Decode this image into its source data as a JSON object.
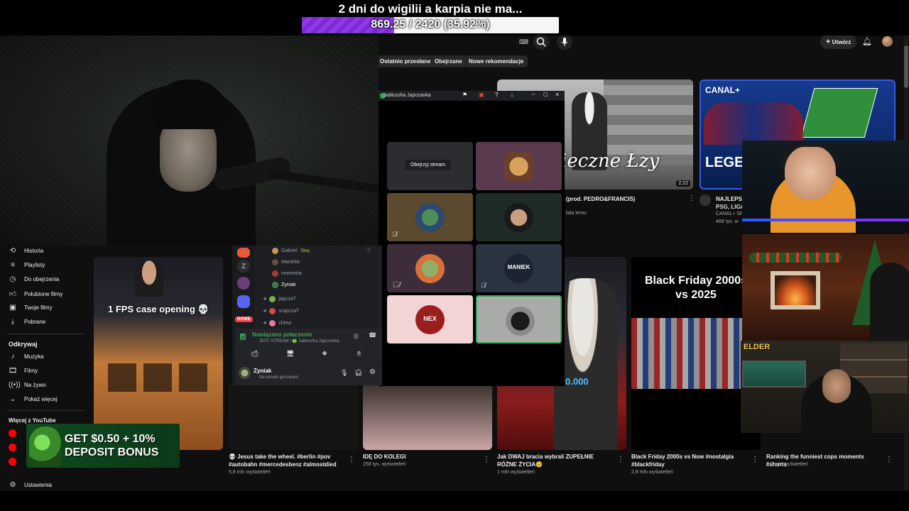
{
  "overlay": {
    "goal_title": "2 dni do wigilii a karpia nie ma...",
    "goal_text": "869.25 / 2420 (35.92%)",
    "goal_fraction": 0.3592,
    "promo_line1": "GET $0.50 + 10%",
    "promo_line2": "DEPOSIT BONUS"
  },
  "youtube": {
    "create_label": "Utwórz",
    "chips": [
      "Ostatnio przesłane",
      "Obejrzane",
      "Nowe rekomendacje"
    ],
    "sidebar": {
      "items": [
        "Historia",
        "Playlisty",
        "Do obejrzenia",
        "Polubione filmy",
        "Twoje filmy",
        "Pobrane"
      ],
      "explore_heading": "Odkrywaj",
      "explore_items": [
        "Muzyka",
        "Filmy",
        "Na żywo",
        "Pokaż więcej"
      ],
      "more_heading": "Więcej z YouTube",
      "settings": "Ustawienia"
    },
    "top_videos": [
      {
        "thumb_text": "ieczne Łzy",
        "duration": "2:22",
        "title": "(prod. PEDRO&FRANCIS)",
        "meta": "lata temu"
      },
      {
        "thumb_brand": "CANAL+",
        "thumb_text": "LEGE",
        "title": "NAJLEPSZ",
        "meta1": "PSG, LIGA",
        "meta2": "CANAL+ SP",
        "meta3": "468 tys. w"
      }
    ],
    "bottom_videos": [
      {
        "thumb_text": "1 FPS case opening 💀",
        "title": "💀 Jesus take the wheel. #berlin #pov #autobahn #mercedesbenz #almostdied",
        "meta": "5,8 mln wyświetleń"
      },
      {
        "title": "IDĘ DO KOLEGI",
        "meta": "258 tys. wyświetleń"
      },
      {
        "thumb_text": "0.000",
        "title": "Jak DWAJ bracia wybrali ZUPEŁNIE RÓŻNE ŻYCIA🥺",
        "meta": "1 mln wyświetleń"
      },
      {
        "thumb_text": "Black Friday 2000s vs 2025",
        "title": "Black Friday 2000s vs Now #nostalgia #blackfriday",
        "meta": "2,8 mln wyświetleń"
      },
      {
        "title": "Ranking the funniest cops moments #shorts",
        "meta": "6,7 mln wyświetleń"
      }
    ]
  },
  "discord_call": {
    "window_title": "Jabłuszka Japczanka",
    "watch_stream": "Obejrzyj stream",
    "tile_labels": [
      "MANIEK",
      "NEX"
    ]
  },
  "discord_panel": {
    "server_badge": "NOWE",
    "voice_users": [
      {
        "name": "Gabriel",
        "tag": "78sq"
      },
      {
        "name": "Maniekk"
      },
      {
        "name": "neextrela"
      },
      {
        "name": "Zyniak"
      }
    ],
    "channels": [
      "japczaT",
      "srapczaT",
      "chlew"
    ],
    "connection_status": "Nawiązano połączenie",
    "connection_detail": "JEST STREAM / 🍏 Jabłuszka Japczanka",
    "username": "Zyniak",
    "user_status": "Na kanale głosowym"
  },
  "cam_overlay": {
    "label": "ELDER"
  }
}
